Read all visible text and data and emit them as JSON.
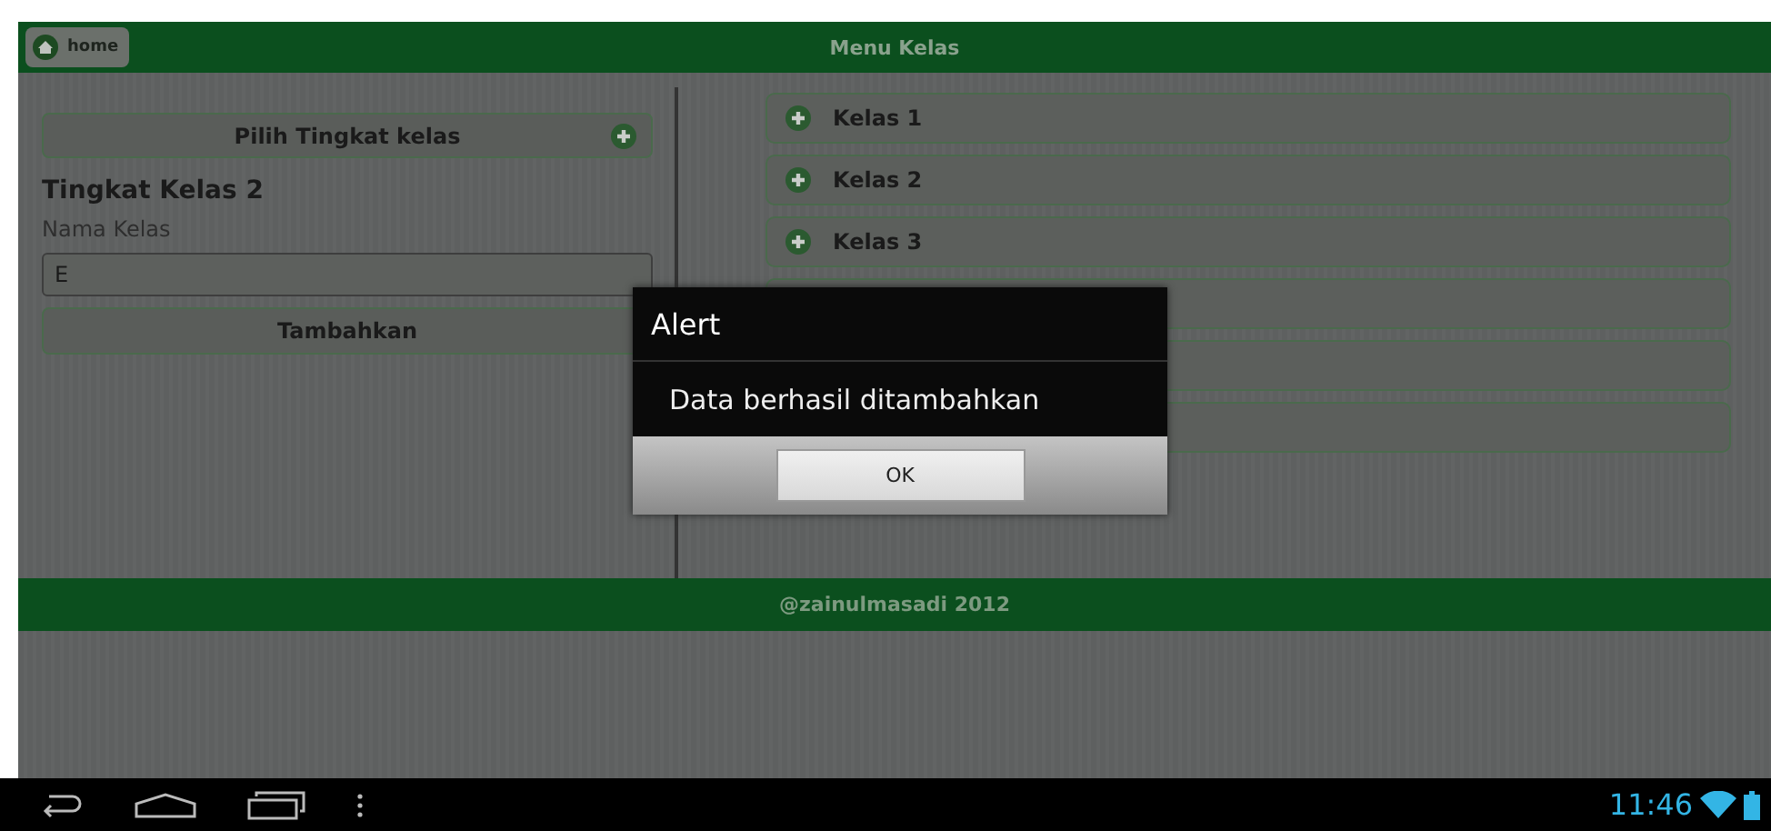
{
  "header": {
    "home_button": "home",
    "title": "Menu Kelas"
  },
  "left_panel": {
    "select_button": "Pilih Tingkat kelas",
    "heading": "Tingkat Kelas 2",
    "field_label": "Nama Kelas",
    "field_value": "E",
    "add_button": "Tambahkan"
  },
  "class_list": [
    {
      "kind": "class",
      "label": "Kelas 1"
    },
    {
      "kind": "class",
      "label": "Kelas 2"
    },
    {
      "kind": "class",
      "label": "Kelas 3"
    },
    {
      "kind": "blank"
    },
    {
      "kind": "blank"
    },
    {
      "kind": "blank"
    }
  ],
  "footer": "@zainulmasadi 2012",
  "dialog": {
    "title": "Alert",
    "message": "Data berhasil ditambahkan",
    "button": "OK"
  },
  "nav_bar": {
    "time": "11:46"
  }
}
